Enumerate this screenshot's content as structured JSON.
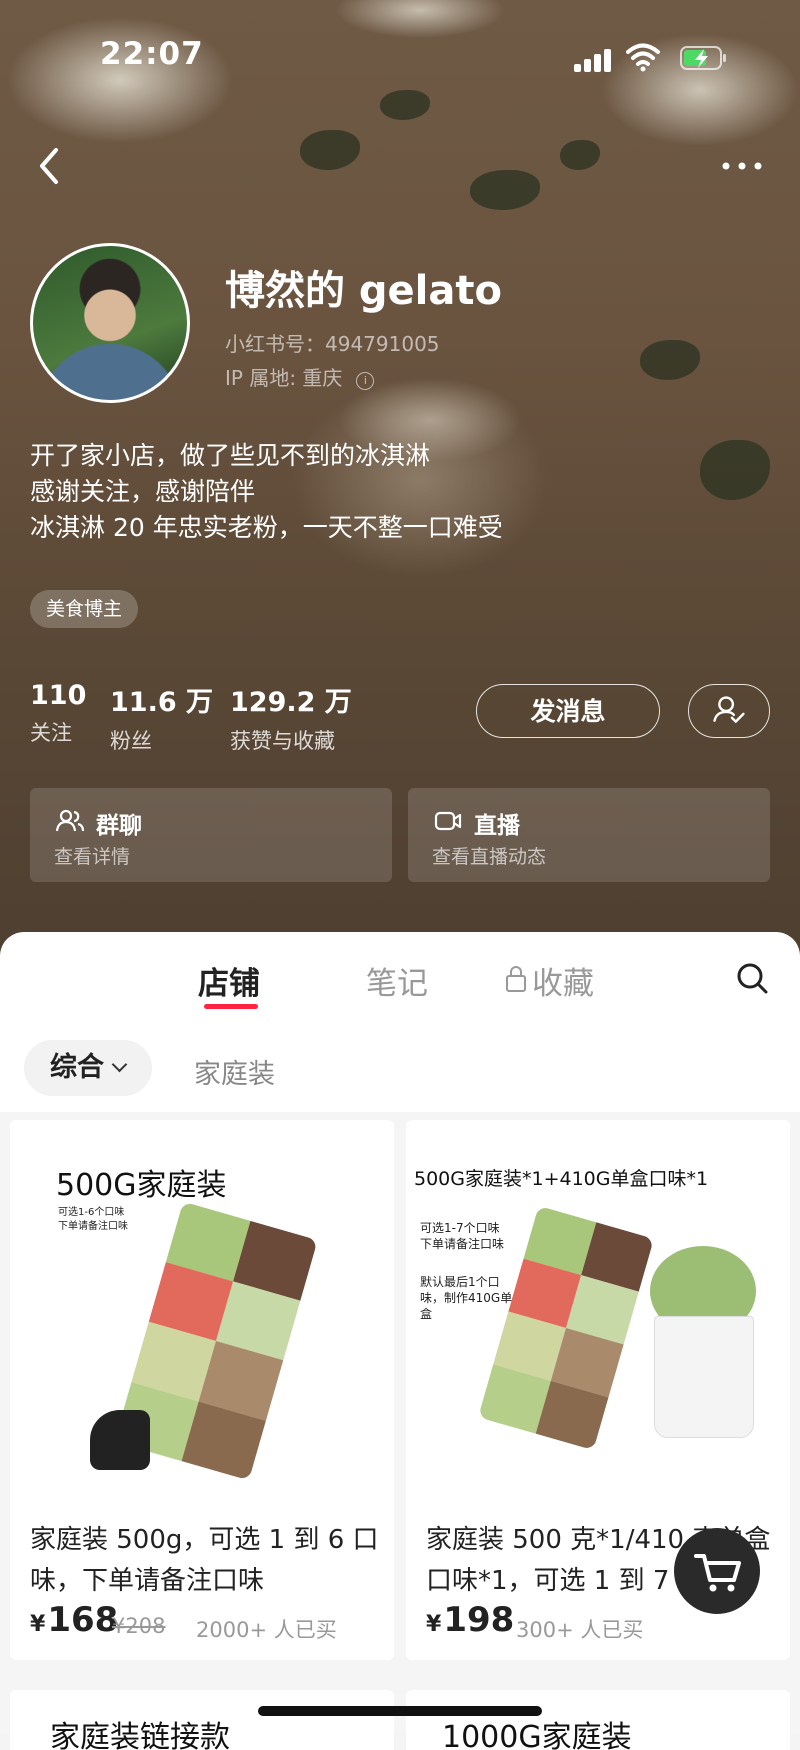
{
  "status_bar": {
    "time": "22:07"
  },
  "profile": {
    "name": "博然的 gelato",
    "red_id": "小红书号：494791005",
    "ip_location": "IP 属地: 重庆",
    "bio": [
      "开了家小店，做了些见不到的冰淇淋",
      "感谢关注，感谢陪伴",
      "冰淇淋 20 年忠实老粉，一天不整一口难受"
    ],
    "tag": "美食博主",
    "stats": [
      {
        "value": "110",
        "label": "关注"
      },
      {
        "value": "11.6 万",
        "label": "粉丝"
      },
      {
        "value": "129.2 万",
        "label": "获赞与收藏"
      }
    ],
    "message_button": "发消息",
    "cards": [
      {
        "title": "群聊",
        "subtitle": "查看详情"
      },
      {
        "title": "直播",
        "subtitle": "查看直播动态"
      }
    ]
  },
  "tabs": [
    {
      "label": "店铺",
      "active": true
    },
    {
      "label": "笔记",
      "active": false
    },
    {
      "label": "收藏",
      "active": false,
      "locked": true
    }
  ],
  "filters": {
    "selected": "综合",
    "other": "家庭装"
  },
  "products": [
    {
      "image_title": "500G家庭装",
      "image_note": [
        "可选1-6个口味",
        "下单请备注口味"
      ],
      "title": "家庭装 500g，可选 1 到 6 口味，下单请备注口味",
      "currency": "¥",
      "price": "168",
      "original_price": "¥208",
      "sold": "2000+ 人已买"
    },
    {
      "image_title": "500G家庭装*1+410G单盒口味*1",
      "image_note": [
        "可选1-7个口味",
        "下单请备注口味"
      ],
      "image_note2": [
        "默认最后1个口",
        "味，制作410G单",
        "盒"
      ],
      "title": "家庭装 500 克*1/410 克单盒口味*1，可选 1 到 7 个口",
      "currency": "¥",
      "price": "198",
      "sold": "300+ 人已买"
    }
  ],
  "next_row": [
    "家庭装链接款",
    "1000G家庭装"
  ],
  "colors": {
    "accent": "#ff2442",
    "hero": "#6a5440"
  },
  "icons": [
    "back-icon",
    "more-icon",
    "group-chat-icon",
    "live-icon",
    "search-icon",
    "lock-icon",
    "cart-icon",
    "follow-check-icon"
  ]
}
